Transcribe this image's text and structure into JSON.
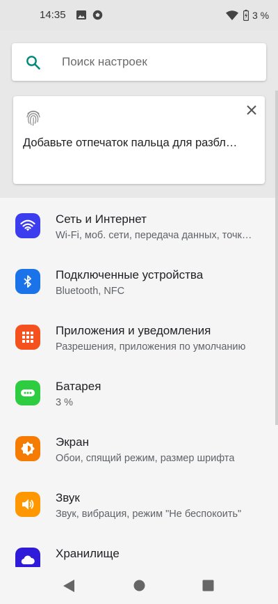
{
  "status_bar": {
    "time": "14:35",
    "battery_text": "3 %"
  },
  "search": {
    "placeholder": "Поиск настроек"
  },
  "suggestion": {
    "text": "Добавьте отпечаток пальца для разбл…"
  },
  "settings": [
    {
      "title": "Сеть и Интернет",
      "summary": "Wi-Fi, моб. сети, передача данных, точк…",
      "icon": "wifi-icon",
      "color": "#3d3df0"
    },
    {
      "title": "Подключенные устройства",
      "summary": "Bluetooth, NFC",
      "icon": "bluetooth-icon",
      "color": "#1a73e8"
    },
    {
      "title": "Приложения и уведомления",
      "summary": "Разрешения, приложения по умолчанию",
      "icon": "apps-icon",
      "color": "#f4511e"
    },
    {
      "title": "Батарея",
      "summary": "3 %",
      "icon": "battery-icon",
      "color": "#2ecc40"
    },
    {
      "title": "Экран",
      "summary": "Обои, спящий режим, размер шрифта",
      "icon": "brightness-icon",
      "color": "#f57c00"
    },
    {
      "title": "Звук",
      "summary": "Звук, вибрация, режим \"Не беспокоить\"",
      "icon": "volume-icon",
      "color": "#ff9800"
    },
    {
      "title": "Хранилище",
      "summary": "",
      "icon": "cloud-icon",
      "color": "#2e1cd9"
    }
  ],
  "colors": {
    "accent": "#00897b"
  }
}
